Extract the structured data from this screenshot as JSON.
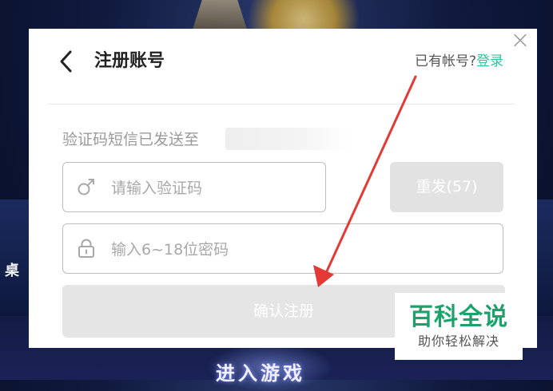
{
  "background": {
    "left_char": "桌",
    "enter_game": "进入游戏"
  },
  "dialog": {
    "title": "注册账号",
    "login_prompt": "已有帐号?",
    "login_link": "登录",
    "close_glyph": "×",
    "sent_message": "验证码短信已发送至",
    "code_placeholder": "请输入验证码",
    "resend_label": "重发(57)",
    "password_placeholder": "输入6~18位密码",
    "submit_label": "确认注册"
  },
  "watermark": {
    "main": "百科全说",
    "sub": "助你轻松解决"
  },
  "colors": {
    "accent": "#33c2a0",
    "arrow": "#e53935",
    "watermark": "#1aa36b"
  },
  "icons": {
    "back": "chevron-left-icon",
    "close": "close-icon",
    "code": "male-symbol-icon",
    "password": "lock-icon"
  }
}
